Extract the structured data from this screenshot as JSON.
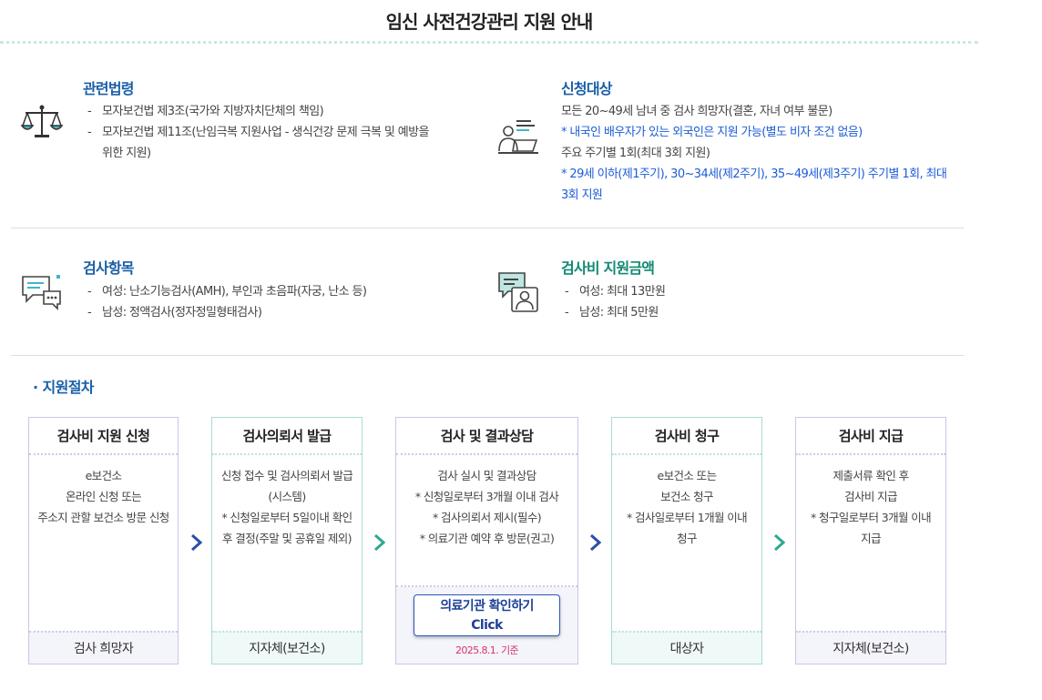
{
  "page": {
    "title": "임신 사전건강관리 지원 안내"
  },
  "law": {
    "heading": "관련법령",
    "items": [
      "모자보건법 제3조(국가와 지방자치단체의 책임)",
      "모자보건법 제11조(난임극복 지원사업 - 생식건강 문제 극복 및 예방을",
      "위한 지원)"
    ]
  },
  "target": {
    "heading": "신청대상",
    "line1": "모든 20~49세 남녀 중 검사 희망자(결혼, 자녀 여부 불문)",
    "line2": "* 내국인 배우자가 있는 외국인은 지원 가능(별도 비자 조건 없음)",
    "line3": "주요 주기별 1회(최대 3회 지원)",
    "line4": "* 29세 이하(제1주기), 30~34세(제2주기), 35~49세(제3주기) 주기별 1회, 최대",
    "line5": "3회 지원"
  },
  "tests": {
    "heading": "검사항목",
    "items": [
      "여성: 난소기능검사(AMH), 부인과 초음파(자궁, 난소 등)",
      "남성: 정액검사(정자정밀형태검사)"
    ]
  },
  "support": {
    "heading": "검사비 지원금액",
    "items": [
      "여성: 최대 13만원",
      "남성: 최대 5만원"
    ]
  },
  "procedure": {
    "title": "· 지원절차",
    "steps": [
      {
        "title": "검사비 지원 신청",
        "lines": [
          "e보건소",
          "온라인 신청 또는",
          "주소지 관할 보건소 방문 신청"
        ],
        "footer": "검사 희망자"
      },
      {
        "title": "검사의뢰서 발급",
        "lines": [
          "신청 접수 및 검사의뢰서 발급",
          "(시스템)",
          "* 신청일로부터 5일이내 확인",
          "후 결정(주말 및 공휴일 제외)"
        ],
        "footer": "지자체(보건소)"
      },
      {
        "title": "검사 및 결과상담",
        "lines": [
          "검사 실시 및 결과상담",
          "* 신청일로부터 3개월 이내 검사",
          "* 검사의뢰서 제시(필수)",
          "* 의료기관 예약 후 방문(권고)"
        ],
        "button_line1": "의료기관 확인하기",
        "button_line2": "Click",
        "basis": "2025.8.1. 기준"
      },
      {
        "title": "검사비 청구",
        "lines": [
          "e보건소 또는",
          "보건소 청구",
          "* 검사일로부터 1개월 이내",
          "청구"
        ],
        "footer": "대상자"
      },
      {
        "title": "검사비 지급",
        "lines": [
          "제출서류 확인 후",
          "검사비 지급",
          "* 청구일로부터 3개월 이내",
          "지급"
        ],
        "footer": "지자체(보건소)"
      }
    ]
  },
  "colors": {
    "blue": "#1a5fa8",
    "green": "#128a73",
    "note": "#1c5cd8",
    "arrow_blue": "#2a4fa8",
    "arrow_teal": "#2ea88f"
  },
  "icons": [
    "scale-icon",
    "person-laptop-icon",
    "chat-bubble-icon",
    "video-consult-icon",
    "chevron-right-icon"
  ]
}
